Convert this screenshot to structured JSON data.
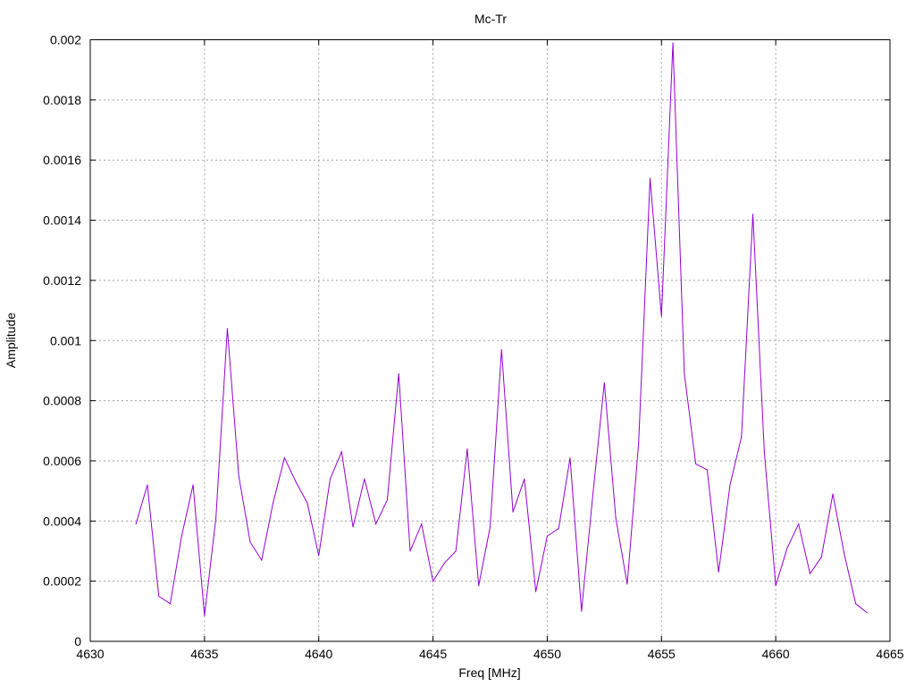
{
  "chart_data": {
    "type": "line",
    "title": "Mc-Tr",
    "xlabel": "Freq [MHz]",
    "ylabel": "Amplitude",
    "xlim": [
      4630,
      4665
    ],
    "ylim": [
      0,
      0.002
    ],
    "x_ticks": [
      "4630",
      "4635",
      "4640",
      "4645",
      "4650",
      "4655",
      "4660",
      "4665"
    ],
    "y_ticks": [
      "0",
      "0.0002",
      "0.0004",
      "0.0006",
      "0.0008",
      "0.001",
      "0.0012",
      "0.0014",
      "0.0016",
      "0.0018",
      "0.002"
    ],
    "grid": true,
    "series": [
      {
        "color": "#9400d3",
        "x": [
          4632,
          4632.5,
          4633,
          4633.5,
          4634,
          4634.5,
          4635,
          4635.5,
          4636,
          4636.5,
          4637,
          4637.5,
          4638,
          4638.5,
          4639,
          4639.5,
          4640,
          4640.5,
          4641,
          4641.5,
          4642,
          4642.5,
          4643,
          4643.5,
          4644,
          4644.5,
          4645,
          4645.5,
          4646,
          4646.5,
          4647,
          4647.5,
          4648,
          4648.5,
          4649,
          4649.5,
          4650,
          4650.5,
          4651,
          4651.5,
          4652,
          4652.5,
          4653,
          4653.5,
          4654,
          4654.5,
          4655,
          4655.5,
          4656,
          4656.5,
          4657,
          4657.5,
          4658,
          4658.5,
          4659,
          4659.5,
          4660,
          4660.5,
          4661,
          4661.5,
          4662,
          4662.5,
          4663,
          4663.5,
          4664
        ],
        "y": [
          0.00039,
          0.00052,
          0.00015,
          0.000125,
          0.00035,
          0.00052,
          8.5e-05,
          0.00041,
          0.00104,
          0.00055,
          0.00033,
          0.00027,
          0.00046,
          0.00061,
          0.00053,
          0.00046,
          0.000285,
          0.00054,
          0.00063,
          0.00038,
          0.00054,
          0.00039,
          0.00047,
          0.00089,
          0.0003,
          0.00039,
          0.0002,
          0.00026,
          0.0003,
          0.00064,
          0.000185,
          0.00038,
          0.00097,
          0.00043,
          0.00054,
          0.000165,
          0.00035,
          0.000375,
          0.00061,
          0.0001,
          0.00049,
          0.00086,
          0.00041,
          0.00019,
          0.00066,
          0.00154,
          0.00108,
          0.00199,
          0.00089,
          0.00059,
          0.00057,
          0.00023,
          0.00052,
          0.00068,
          0.00142,
          0.00063,
          0.000185,
          0.00031,
          0.00039,
          0.000225,
          0.00028,
          0.00049,
          0.00029,
          0.000125,
          9.5e-05
        ]
      }
    ]
  }
}
